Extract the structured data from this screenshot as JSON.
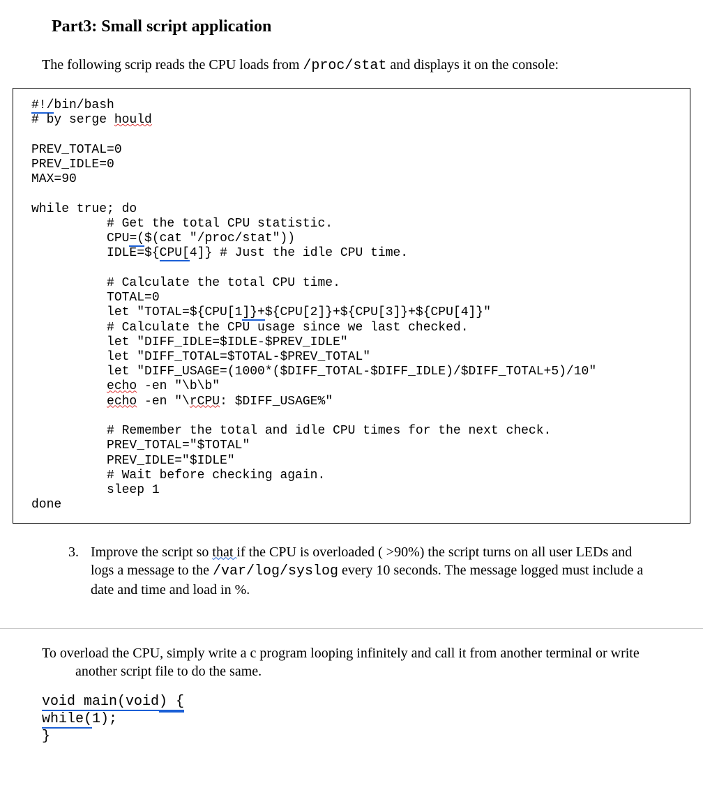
{
  "heading": "Part3: Small script application",
  "intro": {
    "pre": "The following scrip reads the CPU loads from ",
    "code": "/proc/stat",
    "post": " and displays it on the console:"
  },
  "code": {
    "l01a": "#!/",
    "l01b": "bin/bash",
    "l02a": "# by serge ",
    "l02b": "hould",
    "l03": "",
    "l04": "PREV_TOTAL=0",
    "l05": "PREV_IDLE=0",
    "l06": "MAX=90",
    "l07": "",
    "l08": "while true; do",
    "l09": "          # Get the total CPU statistic.",
    "l10a": "          CPU",
    "l10b": "=(",
    "l10c": "$(cat \"/proc/stat\"))",
    "l11a": "          IDLE=${",
    "l11b": "CPU[",
    "l11c": "4]} # Just the idle CPU time.",
    "l12": "",
    "l13": "          # Calculate the total CPU time.",
    "l14": "          TOTAL=0",
    "l15a": "          let \"TOTAL=${CPU[1",
    "l15b": "]}+",
    "l15c": "${CPU[2]}+${CPU[3]}+${CPU[4]}\"",
    "l16": "          # Calculate the CPU usage since we last checked.",
    "l17": "          let \"DIFF_IDLE=$IDLE-$PREV_IDLE\"",
    "l18": "          let \"DIFF_TOTAL=$TOTAL-$PREV_TOTAL\"",
    "l19": "          let \"DIFF_USAGE=(1000*($DIFF_TOTAL-$DIFF_IDLE)/$DIFF_TOTAL+5)/10\"",
    "l20a": "          ",
    "l20b": "echo",
    "l20c": " -en \"\\b\\b\"",
    "l21a": "          ",
    "l21b": "echo",
    "l21c": " -en \"\\",
    "l21d": "rCPU",
    "l21e": ": $DIFF_USAGE%\"",
    "l22": "",
    "l23": "          # Remember the total and idle CPU times for the next check.",
    "l24": "          PREV_TOTAL=\"$TOTAL\"",
    "l25": "          PREV_IDLE=\"$IDLE\"",
    "l26": "          # Wait before checking again.",
    "l27": "          sleep 1",
    "l28": "done"
  },
  "question": {
    "pre": "Improve the script so ",
    "u1": "that ",
    "mid1": "if the CPU  is overloaded ( >90%) the script turns on all user LEDs and logs a message to the ",
    "code": "/var/log/syslog",
    "mid2": " every 10 seconds. The message logged must include a date and time and load in %."
  },
  "overload": {
    "text": "To overload the CPU, simply write a c program looping infinitely and call it from another terminal or write another script file to do the same."
  },
  "snippet": {
    "l1a": "void main(void",
    "l1b": ") {",
    "l2a": "while(",
    "l2b": "1);",
    "l3": "}"
  }
}
